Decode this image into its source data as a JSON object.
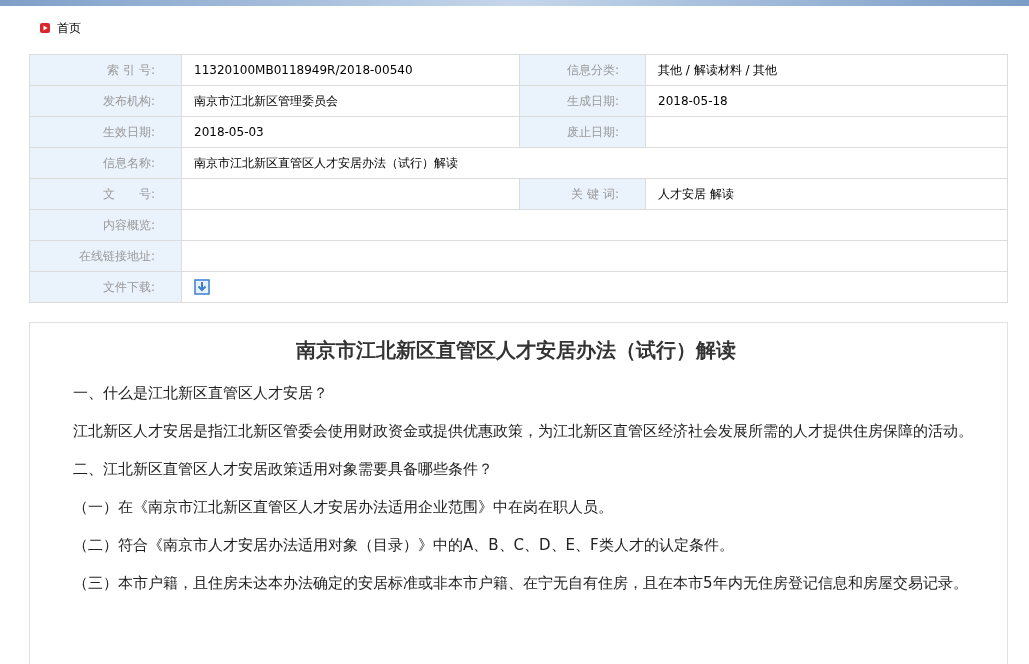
{
  "breadcrumb": "首页",
  "info_table": [
    {
      "fields": [
        {
          "kind": "text",
          "label": "索 引 号:",
          "value": "11320100MB0118949R/2018-00540"
        },
        {
          "kind": "text",
          "label": "信息分类:",
          "value": "其他 / 解读材料 / 其他"
        }
      ]
    },
    {
      "fields": [
        {
          "kind": "text",
          "label": "发布机构:",
          "value": "南京市江北新区管理委员会"
        },
        {
          "kind": "text",
          "label": "生成日期:",
          "value": "2018-05-18"
        }
      ]
    },
    {
      "fields": [
        {
          "kind": "text",
          "label": "生效日期:",
          "value": "2018-05-03"
        },
        {
          "kind": "text",
          "label": "废止日期:"
        }
      ]
    },
    {
      "fields": [
        {
          "kind": "text",
          "label": "信息名称:",
          "value": "南京市江北新区直管区人才安居办法（试行）解读"
        }
      ]
    },
    {
      "fields": [
        {
          "kind": "text",
          "label": "文　　号:"
        },
        {
          "kind": "text",
          "label": "关 键 词:",
          "value": "人才安居 解读"
        }
      ]
    },
    {
      "fields": [
        {
          "kind": "text",
          "label": "内容概览:"
        }
      ]
    },
    {
      "fields": [
        {
          "kind": "text",
          "label": "在线链接地址:"
        }
      ]
    },
    {
      "fields": [
        {
          "kind": "download",
          "label": "文件下载:"
        }
      ]
    }
  ],
  "article": {
    "title": "南京市江北新区直管区人才安居办法（试行）解读",
    "paragraphs": [
      "一、什么是江北新区直管区人才安居？",
      "江北新区人才安居是指江北新区管委会使用财政资金或提供优惠政策，为江北新区直管区经济社会发展所需的人才提供住房保障的活动。",
      "二、江北新区直管区人才安居政策适用对象需要具备哪些条件？",
      "（一）在《南京市江北新区直管区人才安居办法适用企业范围》中在岗在职人员。",
      "（二）符合《南京市人才安居办法适用对象（目录）》中的A、B、C、D、E、F类人才的认定条件。",
      "（三）本市户籍，且住房未达本办法确定的安居标准或非本市户籍、在宁无自有住房，且在本市5年内无住房登记信息和房屋交易记录。"
    ]
  }
}
